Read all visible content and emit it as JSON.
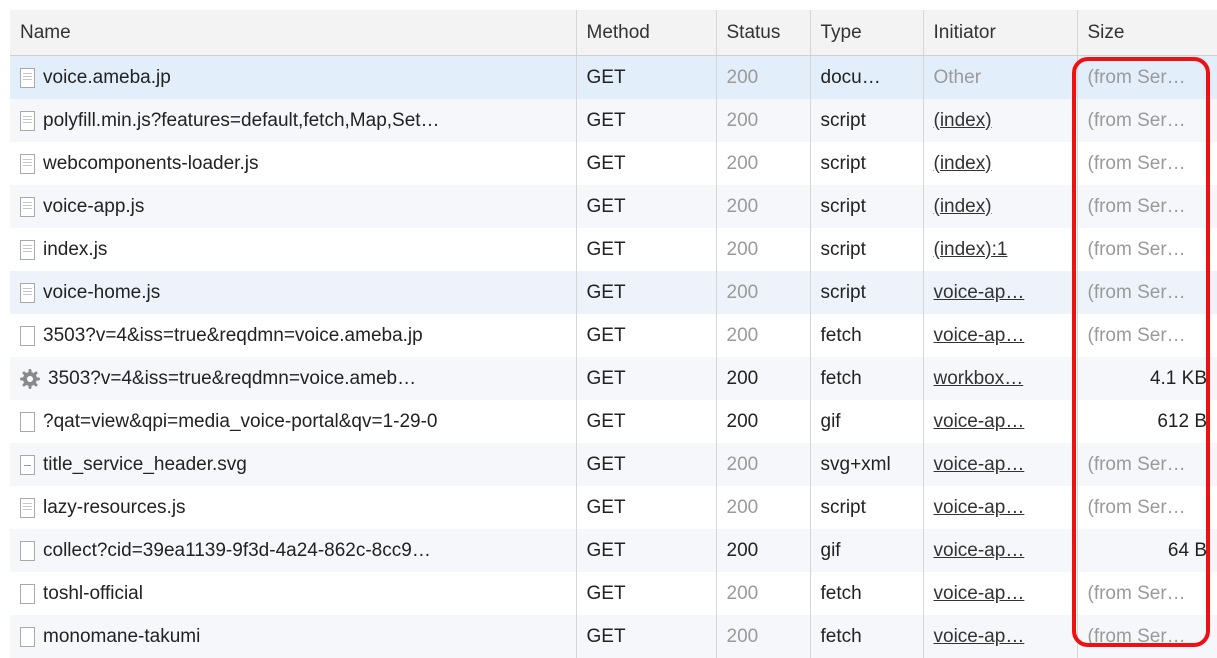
{
  "columns": {
    "name": "Name",
    "method": "Method",
    "status": "Status",
    "type": "Type",
    "initiator": "Initiator",
    "size": "Size"
  },
  "rows": [
    {
      "name": "voice.ameba.jp",
      "icon": "document-icon",
      "method": "GET",
      "status": "200",
      "type": "docu…",
      "initiator": "Other",
      "size": "(from Ser…",
      "dimmed": true,
      "initiator_link": false,
      "size_from_cache": true
    },
    {
      "name": "polyfill.min.js?features=default,fetch,Map,Set…",
      "icon": "document-icon",
      "method": "GET",
      "status": "200",
      "type": "script",
      "initiator": "(index)",
      "size": "(from Ser…",
      "dimmed": true,
      "initiator_link": true,
      "size_from_cache": true
    },
    {
      "name": "webcomponents-loader.js",
      "icon": "document-icon",
      "method": "GET",
      "status": "200",
      "type": "script",
      "initiator": "(index)",
      "size": "(from Ser…",
      "dimmed": true,
      "initiator_link": true,
      "size_from_cache": true
    },
    {
      "name": "voice-app.js",
      "icon": "document-icon",
      "method": "GET",
      "status": "200",
      "type": "script",
      "initiator": "(index)",
      "size": "(from Ser…",
      "dimmed": true,
      "initiator_link": true,
      "size_from_cache": true
    },
    {
      "name": "index.js",
      "icon": "document-icon",
      "method": "GET",
      "status": "200",
      "type": "script",
      "initiator": "(index):1",
      "size": "(from Ser…",
      "dimmed": true,
      "initiator_link": true,
      "size_from_cache": true
    },
    {
      "name": "voice-home.js",
      "icon": "document-icon",
      "method": "GET",
      "status": "200",
      "type": "script",
      "initiator": "voice-ap…",
      "size": "(from Ser…",
      "dimmed": true,
      "initiator_link": true,
      "size_from_cache": true
    },
    {
      "name": "3503?v=4&iss=true&reqdmn=voice.ameba.jp",
      "icon": "blank-file-icon",
      "method": "GET",
      "status": "200",
      "type": "fetch",
      "initiator": "voice-ap…",
      "size": "(from Ser…",
      "dimmed": true,
      "initiator_link": true,
      "size_from_cache": true
    },
    {
      "name": "3503?v=4&iss=true&reqdmn=voice.ameb…",
      "icon": "gear-icon",
      "method": "GET",
      "status": "200",
      "type": "fetch",
      "initiator": "workbox…",
      "size": "4.1 KB",
      "dimmed": false,
      "initiator_link": true,
      "size_from_cache": false
    },
    {
      "name": "?qat=view&qpi=media_voice-portal&qv=1-29-0",
      "icon": "blank-file-icon",
      "method": "GET",
      "status": "200",
      "type": "gif",
      "initiator": "voice-ap…",
      "size": "612 B",
      "dimmed": false,
      "initiator_link": true,
      "size_from_cache": false
    },
    {
      "name": "title_service_header.svg",
      "icon": "svg-file-icon",
      "method": "GET",
      "status": "200",
      "type": "svg+xml",
      "initiator": "voice-ap…",
      "size": "(from Ser…",
      "dimmed": true,
      "initiator_link": true,
      "size_from_cache": true
    },
    {
      "name": "lazy-resources.js",
      "icon": "document-icon",
      "method": "GET",
      "status": "200",
      "type": "script",
      "initiator": "voice-ap…",
      "size": "(from Ser…",
      "dimmed": true,
      "initiator_link": true,
      "size_from_cache": true
    },
    {
      "name": "collect?cid=39ea1139-9f3d-4a24-862c-8cc9…",
      "icon": "blank-file-icon",
      "method": "GET",
      "status": "200",
      "type": "gif",
      "initiator": "voice-ap…",
      "size": "64 B",
      "dimmed": false,
      "initiator_link": true,
      "size_from_cache": false
    },
    {
      "name": "toshl-official",
      "icon": "blank-file-icon",
      "method": "GET",
      "status": "200",
      "type": "fetch",
      "initiator": "voice-ap…",
      "size": "(from Ser…",
      "dimmed": true,
      "initiator_link": true,
      "size_from_cache": true
    },
    {
      "name": "monomane-takumi",
      "icon": "blank-file-icon",
      "method": "GET",
      "status": "200",
      "type": "fetch",
      "initiator": "voice-ap…",
      "size": "(from Ser…",
      "dimmed": true,
      "initiator_link": true,
      "size_from_cache": true
    }
  ],
  "colors": {
    "highlight": "#ee1111",
    "selected_row": "#e3eefb",
    "muted_text": "#9a9a9a",
    "header_bg": "#f3f3f3"
  }
}
